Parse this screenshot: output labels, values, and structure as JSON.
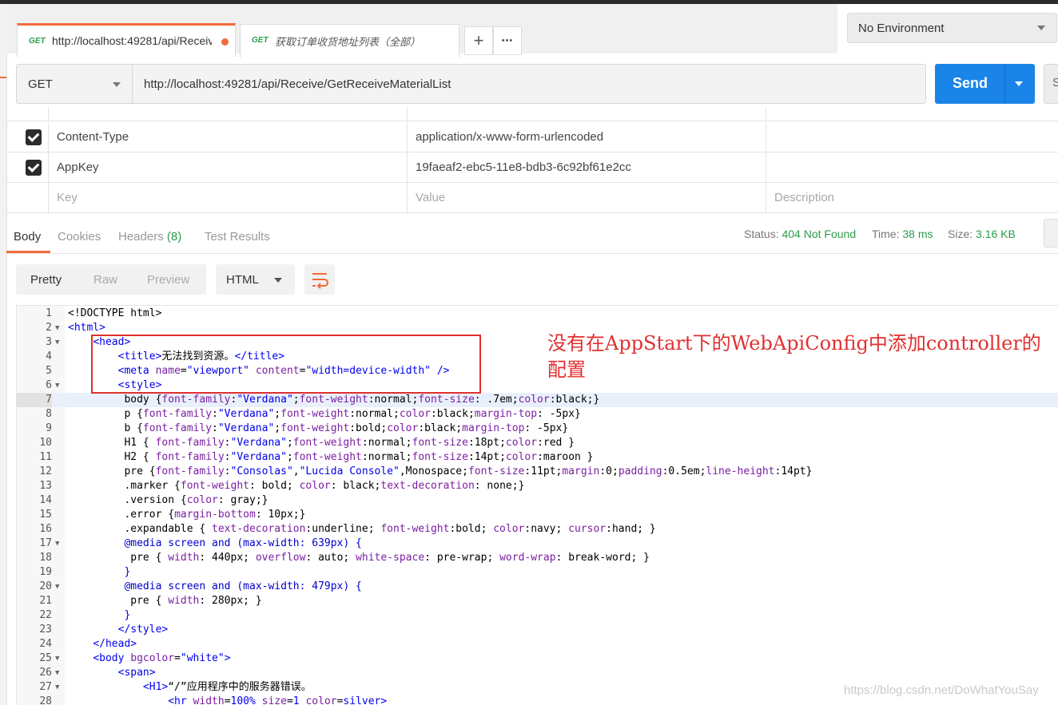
{
  "tabs": [
    {
      "method": "GET",
      "title": "http://localhost:49281/api/Receiv",
      "unsaved": true
    },
    {
      "method": "GET",
      "title": "获取订单收货地址列表（全部）"
    }
  ],
  "tab_actions": {
    "add_icon": "plus-icon",
    "more_icon": "ellipsis-icon",
    "add_glyph": "+",
    "more_glyph": "•••"
  },
  "environment": {
    "selected": "No Environment"
  },
  "request": {
    "method": "GET",
    "url": "http://localhost:49281/api/Receive/GetReceiveMaterialList",
    "send_label": "Send",
    "save_glyph": "S"
  },
  "headers": {
    "rows": [
      {
        "checked": true,
        "key": "Content-Type",
        "value": "application/x-www-form-urlencoded",
        "description": ""
      },
      {
        "checked": true,
        "key": "AppKey",
        "value": "19faeaf2-ebc5-11e8-bdb3-6c92bf61e2cc",
        "description": ""
      }
    ],
    "placeholders": {
      "key": "Key",
      "value": "Value",
      "description": "Description"
    }
  },
  "response": {
    "tabs": [
      {
        "label": "Body"
      },
      {
        "label": "Cookies"
      },
      {
        "label": "Headers",
        "count": "(8)"
      },
      {
        "label": "Test Results"
      }
    ],
    "status_label": "Status:",
    "status": "404 Not Found",
    "time_label": "Time:",
    "time": "38 ms",
    "size_label": "Size:",
    "size": "3.16 KB",
    "view_modes": [
      "Pretty",
      "Raw",
      "Preview"
    ],
    "format": "HTML"
  },
  "annotation": {
    "text": "没有在AppStart下的WebApiConfig中添加controller的配置"
  },
  "watermark": "https://blog.csdn.net/DoWhatYouSay",
  "colors": {
    "accent": "#f26b3a",
    "send": "#1a84e8",
    "success": "#2a9d4a",
    "annotation": "#e03030"
  },
  "code_lines": [
    {
      "n": "1",
      "fold": false,
      "html": "&lt;!DOCTYPE html&gt;"
    },
    {
      "n": "2",
      "fold": true,
      "html": "<span class='t'>&lt;html&gt;</span>"
    },
    {
      "n": "3",
      "fold": true,
      "html": "    <span class='t'>&lt;head&gt;</span>"
    },
    {
      "n": "4",
      "fold": false,
      "html": "        <span class='t'>&lt;title&gt;</span>无法找到资源。<span class='t'>&lt;/title&gt;</span>"
    },
    {
      "n": "5",
      "fold": false,
      "html": "        <span class='t'>&lt;meta</span> <span class='p'>name</span>=<span class='v'>\"viewport\"</span> <span class='p'>content</span>=<span class='v'>\"width=device-width\"</span> <span class='t'>/&gt;</span>"
    },
    {
      "n": "6",
      "fold": true,
      "html": "        <span class='t'>&lt;style&gt;</span>"
    },
    {
      "n": "7",
      "fold": false,
      "current": true,
      "html": "         body {<span class='p'>font-family</span>:<span class='v'>\"Verdana\"</span>;<span class='p'>font-weight</span>:normal;<span class='p'>font-size</span>: .7em;<span class='p'>color</span>:black;}"
    },
    {
      "n": "8",
      "fold": false,
      "html": "         p {<span class='p'>font-family</span>:<span class='v'>\"Verdana\"</span>;<span class='p'>font-weight</span>:normal;<span class='p'>color</span>:black;<span class='p'>margin-top</span>: -5px}"
    },
    {
      "n": "9",
      "fold": false,
      "html": "         b {<span class='p'>font-family</span>:<span class='v'>\"Verdana\"</span>;<span class='p'>font-weight</span>:bold;<span class='p'>color</span>:black;<span class='p'>margin-top</span>: -5px}"
    },
    {
      "n": "10",
      "fold": false,
      "html": "         H1 { <span class='p'>font-family</span>:<span class='v'>\"Verdana\"</span>;<span class='p'>font-weight</span>:normal;<span class='p'>font-size</span>:18pt;<span class='p'>color</span>:red }"
    },
    {
      "n": "11",
      "fold": false,
      "html": "         H2 { <span class='p'>font-family</span>:<span class='v'>\"Verdana\"</span>;<span class='p'>font-weight</span>:normal;<span class='p'>font-size</span>:14pt;<span class='p'>color</span>:maroon }"
    },
    {
      "n": "12",
      "fold": false,
      "html": "         pre {<span class='p'>font-family</span>:<span class='v'>\"Consolas\"</span>,<span class='v'>\"Lucida Console\"</span>,Monospace;<span class='p'>font-size</span>:11pt;<span class='p'>margin</span>:0;<span class='p'>padding</span>:0.5em;<span class='p'>line-height</span>:14pt}"
    },
    {
      "n": "13",
      "fold": false,
      "html": "         .marker {<span class='p'>font-weight</span>: bold; <span class='p'>color</span>: black;<span class='p'>text-decoration</span>: none;}"
    },
    {
      "n": "14",
      "fold": false,
      "html": "         .version {<span class='p'>color</span>: gray;}"
    },
    {
      "n": "15",
      "fold": false,
      "html": "         .error {<span class='p'>margin-bottom</span>: 10px;}"
    },
    {
      "n": "16",
      "fold": false,
      "html": "         .expandable { <span class='p'>text-decoration</span>:underline; <span class='p'>font-weight</span>:bold; <span class='p'>color</span>:navy; <span class='p'>cursor</span>:hand; }"
    },
    {
      "n": "17",
      "fold": true,
      "html": "         <span class='k'>@media screen and (max-width: 639px) {</span>"
    },
    {
      "n": "18",
      "fold": false,
      "html": "          pre { <span class='p'>width</span>: 440px; <span class='p'>overflow</span>: auto; <span class='p'>white-space</span>: pre-wrap; <span class='p'>word-wrap</span>: break-word; }"
    },
    {
      "n": "19",
      "fold": false,
      "html": "         <span class='k'>}</span>"
    },
    {
      "n": "20",
      "fold": true,
      "html": "         <span class='k'>@media screen and (max-width: 479px) {</span>"
    },
    {
      "n": "21",
      "fold": false,
      "html": "          pre { <span class='p'>width</span>: 280px; }"
    },
    {
      "n": "22",
      "fold": false,
      "html": "         <span class='k'>}</span>"
    },
    {
      "n": "23",
      "fold": false,
      "html": "        <span class='t'>&lt;/style&gt;</span>"
    },
    {
      "n": "24",
      "fold": false,
      "html": "    <span class='t'>&lt;/head&gt;</span>"
    },
    {
      "n": "25",
      "fold": true,
      "html": "    <span class='t'>&lt;body</span> <span class='p'>bgcolor</span>=<span class='v'>\"white\"</span><span class='t'>&gt;</span>"
    },
    {
      "n": "26",
      "fold": true,
      "html": "        <span class='t'>&lt;span&gt;</span>"
    },
    {
      "n": "27",
      "fold": true,
      "html": "            <span class='t'>&lt;H1&gt;</span>“/”应用程序中的服务器错误。"
    },
    {
      "n": "28",
      "fold": false,
      "html": "                <span class='t'>&lt;hr</span> <span class='p'>width</span>=<span class='v'>100%</span> <span class='p'>size</span>=<span class='v'>1</span> <span class='p'>color</span>=<span class='v'>silver</span><span class='t'>&gt;</span>"
    }
  ]
}
